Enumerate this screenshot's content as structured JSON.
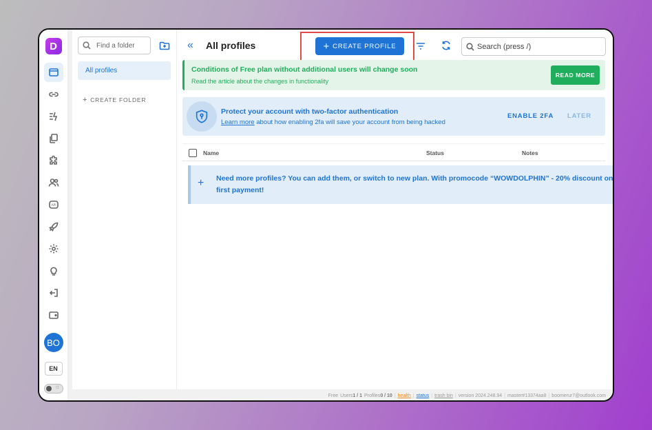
{
  "app": {
    "logo_letter": "D",
    "accent": "#1e73d4",
    "brand": "#a13fce"
  },
  "rail": {
    "items": [
      {
        "icon": "browser-icon",
        "active": true
      },
      {
        "icon": "link-icon"
      },
      {
        "icon": "automation-icon"
      },
      {
        "icon": "copy-icon"
      },
      {
        "icon": "puzzle-icon"
      },
      {
        "icon": "users-icon"
      },
      {
        "icon": "api-icon",
        "label": "API"
      },
      {
        "icon": "rocket-icon"
      },
      {
        "icon": "gear-icon"
      },
      {
        "icon": "lightbulb-icon"
      },
      {
        "icon": "logout-icon"
      },
      {
        "icon": "wallet-icon"
      }
    ],
    "avatar": "BO",
    "language": "EN"
  },
  "folders": {
    "search_placeholder": "Find a folder",
    "items": [
      {
        "label": "All profiles",
        "active": true
      }
    ],
    "create_label": "CREATE FOLDER"
  },
  "header": {
    "title": "All profiles",
    "create_button": "CREATE PROFILE",
    "search_placeholder": "Search (press /)"
  },
  "notice": {
    "title": "Conditions of Free plan without additional users will change soon",
    "subtitle": "Read the article about the changes in functionality",
    "button": "READ MORE",
    "color": "#1fae5b"
  },
  "two_fa": {
    "title": "Protect your account with two-factor authentication",
    "link": "Learn more",
    "subtitle": " about how enabling 2fa will save your account from being hacked",
    "enable": "ENABLE 2FA",
    "later": "LATER"
  },
  "table": {
    "columns": [
      "Name",
      "Status",
      "Notes"
    ]
  },
  "promo": {
    "line1": "Need more profiles? You can add them, or switch to new plan. With promocode “WOWDOLPHIN” - 20% discount on",
    "line2": "first payment!"
  },
  "footer": {
    "plan": "Free",
    "users_label": "Users",
    "users": "1 / 1",
    "profiles_label": "Profiles",
    "profiles": "0 / 10",
    "health": "health",
    "status": "status",
    "trash": "trash bin",
    "version": "version 2024.248.94",
    "branch": "master#13374aa8",
    "email": "boomerur7@outlook.com"
  }
}
